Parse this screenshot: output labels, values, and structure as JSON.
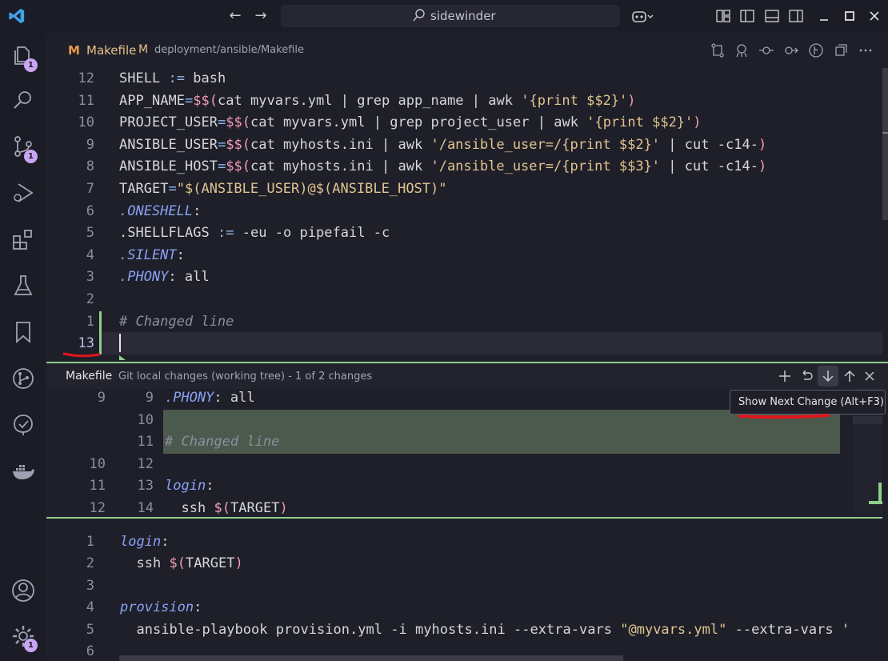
{
  "titlebar": {
    "search_text": "sidewinder",
    "nav_back": "←",
    "nav_forward": "→"
  },
  "activity": {
    "explorer_badge": "1",
    "scm_badge": "1",
    "settings_badge": "1"
  },
  "tab": {
    "filename": "Makefile",
    "modified_flag": "M",
    "path": "deployment/ansible/Makefile",
    "icon_letter": "M"
  },
  "editor_lines": [
    {
      "num": "12",
      "text": "SHELL := bash"
    },
    {
      "num": "11",
      "text": "APP_NAME=$$(cat myvars.yml | grep app_name | awk '{print $$2}')"
    },
    {
      "num": "10",
      "text": "PROJECT_USER=$$(cat myvars.yml | grep project_user | awk '{print $$2}')"
    },
    {
      "num": "9",
      "text": "ANSIBLE_USER=$$(cat myhosts.ini | awk '/ansible_user=/{print $$2}' | cut -c14-)"
    },
    {
      "num": "8",
      "text": "ANSIBLE_HOST=$$(cat myhosts.ini | awk '/ansible_user=/{print $$3}' | cut -c14-)"
    },
    {
      "num": "7",
      "text": "TARGET=\"$(ANSIBLE_USER)@$(ANSIBLE_HOST)\""
    },
    {
      "num": "6",
      "text": ".ONESHELL:"
    },
    {
      "num": "5",
      "text": ".SHELLFLAGS := -eu -o pipefail -c"
    },
    {
      "num": "4",
      "text": ".SILENT:"
    },
    {
      "num": "3",
      "text": ".PHONY: all"
    },
    {
      "num": "2",
      "text": ""
    },
    {
      "num": "1",
      "text": "# Changed line"
    },
    {
      "num": "13",
      "text": ""
    }
  ],
  "diff_header": {
    "file": "Makefile",
    "description": "Git local changes (working tree) - 1 of 2 changes"
  },
  "tooltip": "Show Next Change (Alt+F3)",
  "diff_lines": [
    {
      "old": "9",
      "new": "9",
      "text": ".PHONY: all"
    },
    {
      "old": "",
      "new": "10",
      "text": ""
    },
    {
      "old": "",
      "new": "11",
      "text": "# Changed line"
    },
    {
      "old": "10",
      "new": "12",
      "text": ""
    },
    {
      "old": "11",
      "new": "13",
      "text": "login:"
    },
    {
      "old": "12",
      "new": "14",
      "text": "  ssh $(TARGET)"
    }
  ],
  "lower_lines": [
    {
      "num": "1",
      "text": "login:"
    },
    {
      "num": "2",
      "text": "  ssh $(TARGET)"
    },
    {
      "num": "3",
      "text": ""
    },
    {
      "num": "4",
      "text": "provision:"
    },
    {
      "num": "5",
      "text": "  ansible-playbook provision.yml -i myhosts.ini --extra-vars \"@myvars.yml\" --extra-vars '"
    },
    {
      "num": "6",
      "text": ""
    }
  ],
  "colors": {
    "accent": "#c9a6f2",
    "added_bg": "#4b5a4c",
    "added_gutter": "#8fcf8a",
    "annotation_red": "#e0161b",
    "tab_icon": "#e59a4a"
  }
}
